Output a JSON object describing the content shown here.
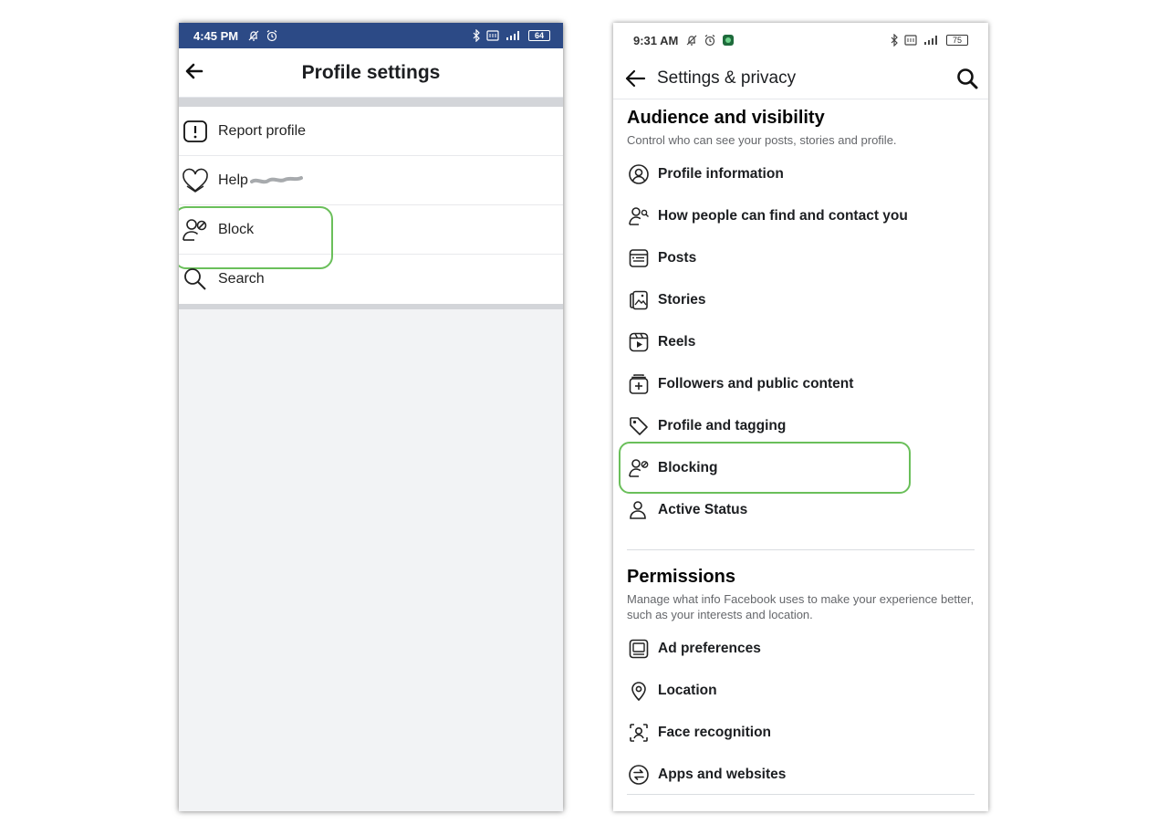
{
  "left_phone": {
    "status_bar": {
      "time": "4:45 PM",
      "battery": "64"
    },
    "header": {
      "title": "Profile settings"
    },
    "menu": [
      {
        "label": "Report profile",
        "icon": "alert-box-icon"
      },
      {
        "label": "Help",
        "icon": "heart-icon"
      },
      {
        "label": "Block",
        "icon": "user-block-icon"
      },
      {
        "label": "Search",
        "icon": "search-icon"
      }
    ]
  },
  "right_phone": {
    "status_bar": {
      "time": "9:31 AM",
      "battery": "75"
    },
    "header": {
      "title": "Settings & privacy"
    },
    "audience": {
      "title": "Audience and visibility",
      "description": "Control who can see your posts, stories and profile.",
      "items": [
        {
          "label": "Profile information",
          "icon": "user-circle-icon"
        },
        {
          "label": "How people can find and contact you",
          "icon": "user-search-icon"
        },
        {
          "label": "Posts",
          "icon": "posts-icon"
        },
        {
          "label": "Stories",
          "icon": "stories-icon"
        },
        {
          "label": "Reels",
          "icon": "reels-icon"
        },
        {
          "label": "Followers and public content",
          "icon": "followers-icon"
        },
        {
          "label": "Profile and tagging",
          "icon": "tag-icon"
        },
        {
          "label": "Blocking",
          "icon": "user-block-icon"
        },
        {
          "label": "Active Status",
          "icon": "active-status-icon"
        }
      ]
    },
    "permissions": {
      "title": "Permissions",
      "description": "Manage what info Facebook uses to make your experience better, such as your interests and location.",
      "items": [
        {
          "label": "Ad preferences",
          "icon": "ad-icon"
        },
        {
          "label": "Location",
          "icon": "location-pin-icon"
        },
        {
          "label": "Face recognition",
          "icon": "face-recognition-icon"
        },
        {
          "label": "Apps and websites",
          "icon": "apps-websites-icon"
        }
      ]
    }
  },
  "colors": {
    "status_bar_left": "#2c4a86",
    "highlight": "#6abf5a",
    "secondary_text": "#65676b"
  }
}
